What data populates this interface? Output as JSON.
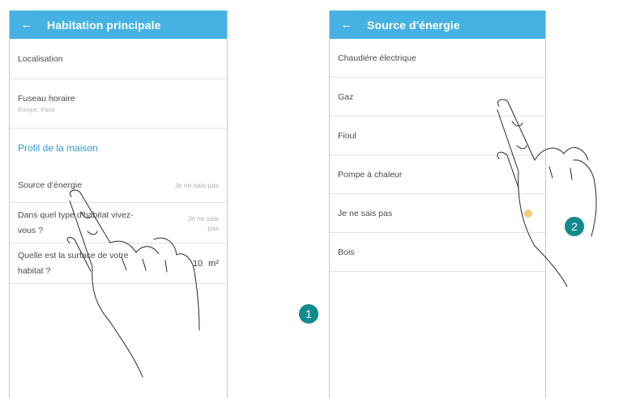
{
  "left_screen": {
    "title": "Habitation principale",
    "back_icon": "arrow-left-icon",
    "rows": {
      "localisation": "Localisation",
      "timezone_label": "Fuseau horaire",
      "timezone_value": "Europe, Paris",
      "section_title": "Profil de la maison",
      "energy_label": "Source d'énergie",
      "energy_value": "Je ne sais pas",
      "habitat_label": "Dans quel type d'habitat vivez-vous ?",
      "habitat_value": "Je ne sais pas",
      "area_label": "Quelle est la surface de votre habitat ?",
      "area_value": "10",
      "area_unit": "m²"
    }
  },
  "right_screen": {
    "title": "Source d'énergie",
    "back_icon": "arrow-left-icon",
    "options": [
      "Chaudière électrique",
      "Gaz",
      "Fioul",
      "Pompe à chaleur",
      "Je ne sais pas",
      "Bois"
    ]
  },
  "steps": {
    "one": "1",
    "two": "2"
  },
  "colors": {
    "appbar": "#46b2e3",
    "section": "#2e9bd6",
    "step_badge": "#118b8e",
    "selected_dot": "#f5b54a"
  }
}
